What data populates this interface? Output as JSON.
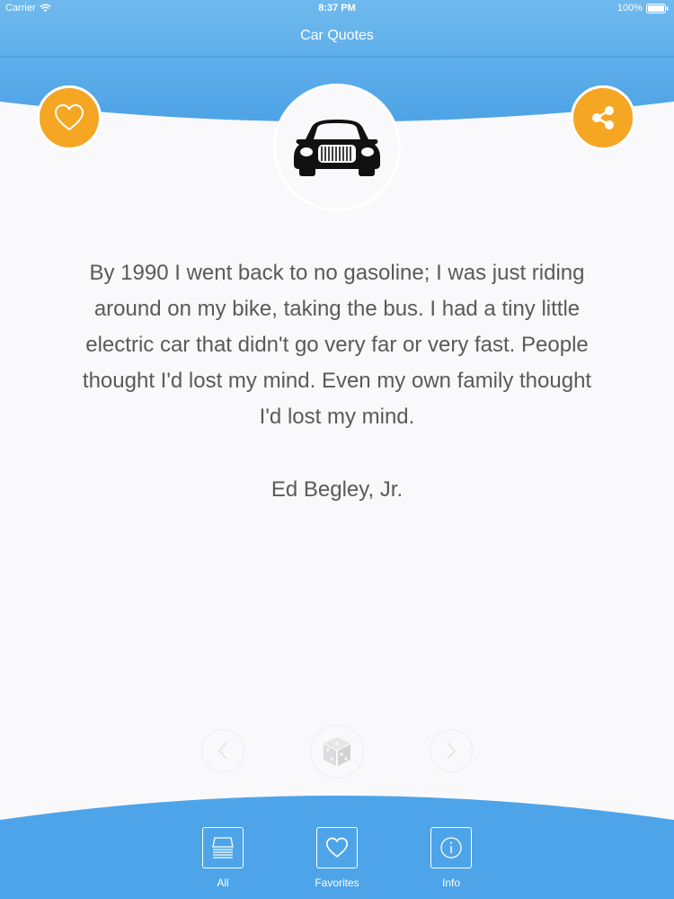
{
  "status_bar": {
    "carrier": "Carrier",
    "time": "8:37 PM",
    "battery": "100%"
  },
  "nav": {
    "title": "Car Quotes"
  },
  "header": {
    "favorite_icon": "heart-outline-icon",
    "share_icon": "share-icon",
    "logo_icon": "car-front-icon"
  },
  "quote": {
    "text": "By 1990 I went back to no gasoline; I was just riding around on my bike, taking the bus. I had a tiny little electric car that didn't go very far or very fast. People thought I'd lost my mind. Even my own family thought I'd lost my mind.",
    "author": "Ed Begley, Jr."
  },
  "controls": {
    "prev_icon": "chevron-left-icon",
    "random_icon": "dice-icon",
    "next_icon": "chevron-right-icon"
  },
  "tabs": [
    {
      "label": "All",
      "icon": "stack-icon"
    },
    {
      "label": "Favorites",
      "icon": "heart-outline-icon"
    },
    {
      "label": "Info",
      "icon": "info-icon"
    }
  ],
  "colors": {
    "primary_blue": "#4da3e6",
    "accent_orange": "#f5a623",
    "background": "#f9f9fb",
    "text": "#5a5a5a"
  }
}
